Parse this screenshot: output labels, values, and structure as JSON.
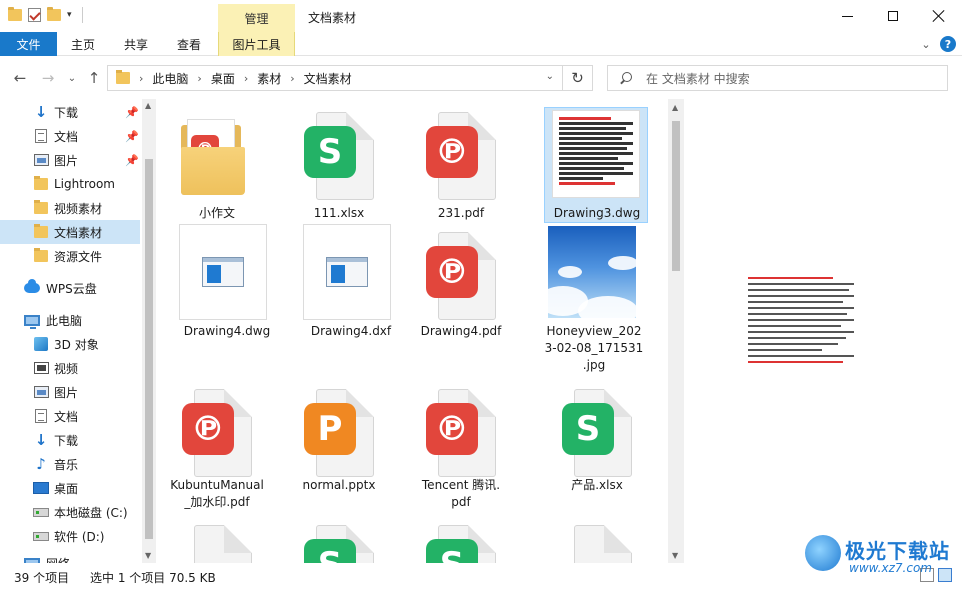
{
  "window": {
    "title": "文档素材",
    "contextual_group": "管理"
  },
  "ribbon": {
    "tabs": [
      "文件",
      "主页",
      "共享",
      "查看",
      "图片工具"
    ],
    "help": "?"
  },
  "address": {
    "breadcrumbs": [
      "此电脑",
      "桌面",
      "素材",
      "文档素材"
    ],
    "search_placeholder": "在 文档素材 中搜索"
  },
  "sidebar": {
    "items": [
      {
        "label": "下载",
        "icon": "download-icon",
        "pinned": true
      },
      {
        "label": "文档",
        "icon": "document-icon",
        "pinned": true
      },
      {
        "label": "图片",
        "icon": "pictures-icon",
        "pinned": true
      },
      {
        "label": "Lightroom",
        "icon": "folder-icon"
      },
      {
        "label": "视频素材",
        "icon": "folder-icon"
      },
      {
        "label": "文档素材",
        "icon": "folder-icon",
        "selected": true
      },
      {
        "label": "资源文件",
        "icon": "folder-icon"
      },
      {
        "label": "WPS云盘",
        "icon": "cloud-icon"
      },
      {
        "label": "此电脑",
        "icon": "computer-icon"
      },
      {
        "label": "3D 对象",
        "icon": "3d-objects-icon"
      },
      {
        "label": "视频",
        "icon": "video-icon"
      },
      {
        "label": "图片",
        "icon": "pictures-icon"
      },
      {
        "label": "文档",
        "icon": "document-icon"
      },
      {
        "label": "下载",
        "icon": "download-icon"
      },
      {
        "label": "音乐",
        "icon": "music-icon"
      },
      {
        "label": "桌面",
        "icon": "desktop-icon"
      },
      {
        "label": "本地磁盘 (C:)",
        "icon": "drive-icon"
      },
      {
        "label": "软件 (D:)",
        "icon": "drive-icon"
      },
      {
        "label": "网络",
        "icon": "network-icon"
      }
    ]
  },
  "files": [
    {
      "name": "小作文",
      "type": "folder"
    },
    {
      "name": "111.xlsx",
      "type": "xlsx"
    },
    {
      "name": "231.pdf",
      "type": "pdf"
    },
    {
      "name": "Drawing3.dwg",
      "type": "dwg-preview",
      "selected": true
    },
    {
      "name": "Drawing4.dwg",
      "type": "cad"
    },
    {
      "name": "Drawing4.dxf",
      "type": "cad"
    },
    {
      "name": "Drawing4.pdf",
      "type": "pdf"
    },
    {
      "name": "Honeyview_2023-02-08_171531.jpg",
      "name_lines": [
        "Honeyview_202",
        "3-02-08_171531",
        ".jpg"
      ],
      "type": "image"
    },
    {
      "name": "KubuntuManual_加水印.pdf",
      "name_lines": [
        "KubuntuManual",
        "_加水印.pdf"
      ],
      "type": "pdf"
    },
    {
      "name": "normal.pptx",
      "type": "pptx"
    },
    {
      "name": "Tencent 腾讯.pdf",
      "name_lines": [
        "Tencent 腾讯.",
        "pdf"
      ],
      "type": "pdf"
    },
    {
      "name": "产品.xlsx",
      "type": "xlsx"
    }
  ],
  "status": {
    "item_count": "39 个项目",
    "selection": "选中 1 个项目  70.5 KB"
  },
  "watermark": {
    "brand": "极光下载站",
    "url": "www.xz7.com"
  },
  "colors": {
    "accent": "#1979ca",
    "selection": "#cce4f7",
    "contextual": "#fbf1b5",
    "wps_green": "#23b266",
    "wps_red": "#e2463c",
    "wps_orange": "#f08822"
  }
}
